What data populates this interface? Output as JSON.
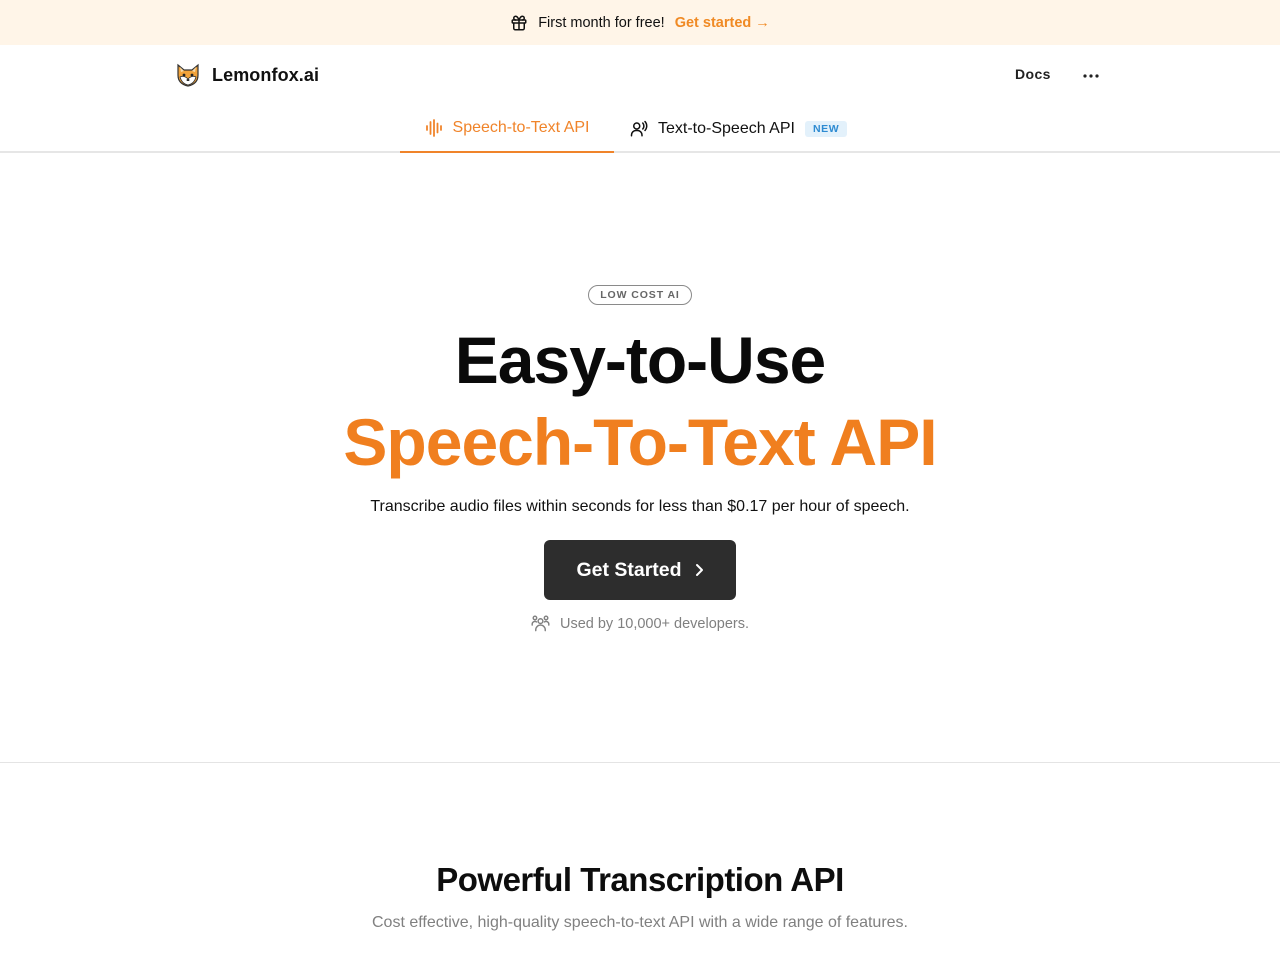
{
  "banner": {
    "icon": "gift-icon",
    "message": "First month for free!",
    "cta_label": "Get started →",
    "accent_color": "#f08a24",
    "background": "#fff5e8"
  },
  "nav": {
    "logo_icon": "fox-icon",
    "brand": "Lemonfox.ai",
    "docs_label": "Docs",
    "more_icon": "more-horizontal-icon"
  },
  "tabs": [
    {
      "label": "Speech-to-Text API",
      "icon": "sound-wave-icon",
      "active": true
    },
    {
      "label": "Text-to-Speech API",
      "icon": "speaking-person-icon",
      "active": false,
      "badge": "NEW"
    }
  ],
  "hero": {
    "eyebrow": "LOW COST AI",
    "title_line1": "Easy-to-Use",
    "title_line2": "Speech-To-Text API",
    "subtitle": "Transcribe audio files within seconds for less than $0.17 per hour of speech.",
    "cta_label": "Get Started",
    "cta_icon": "chevron-right-icon",
    "social_icon": "users-icon",
    "social_proof": "Used by 10,000+ developers.",
    "accent_color": "#f07f1f"
  },
  "features": {
    "title": "Powerful Transcription API",
    "subtitle": "Cost effective, high-quality speech-to-text API with a wide range of features."
  }
}
